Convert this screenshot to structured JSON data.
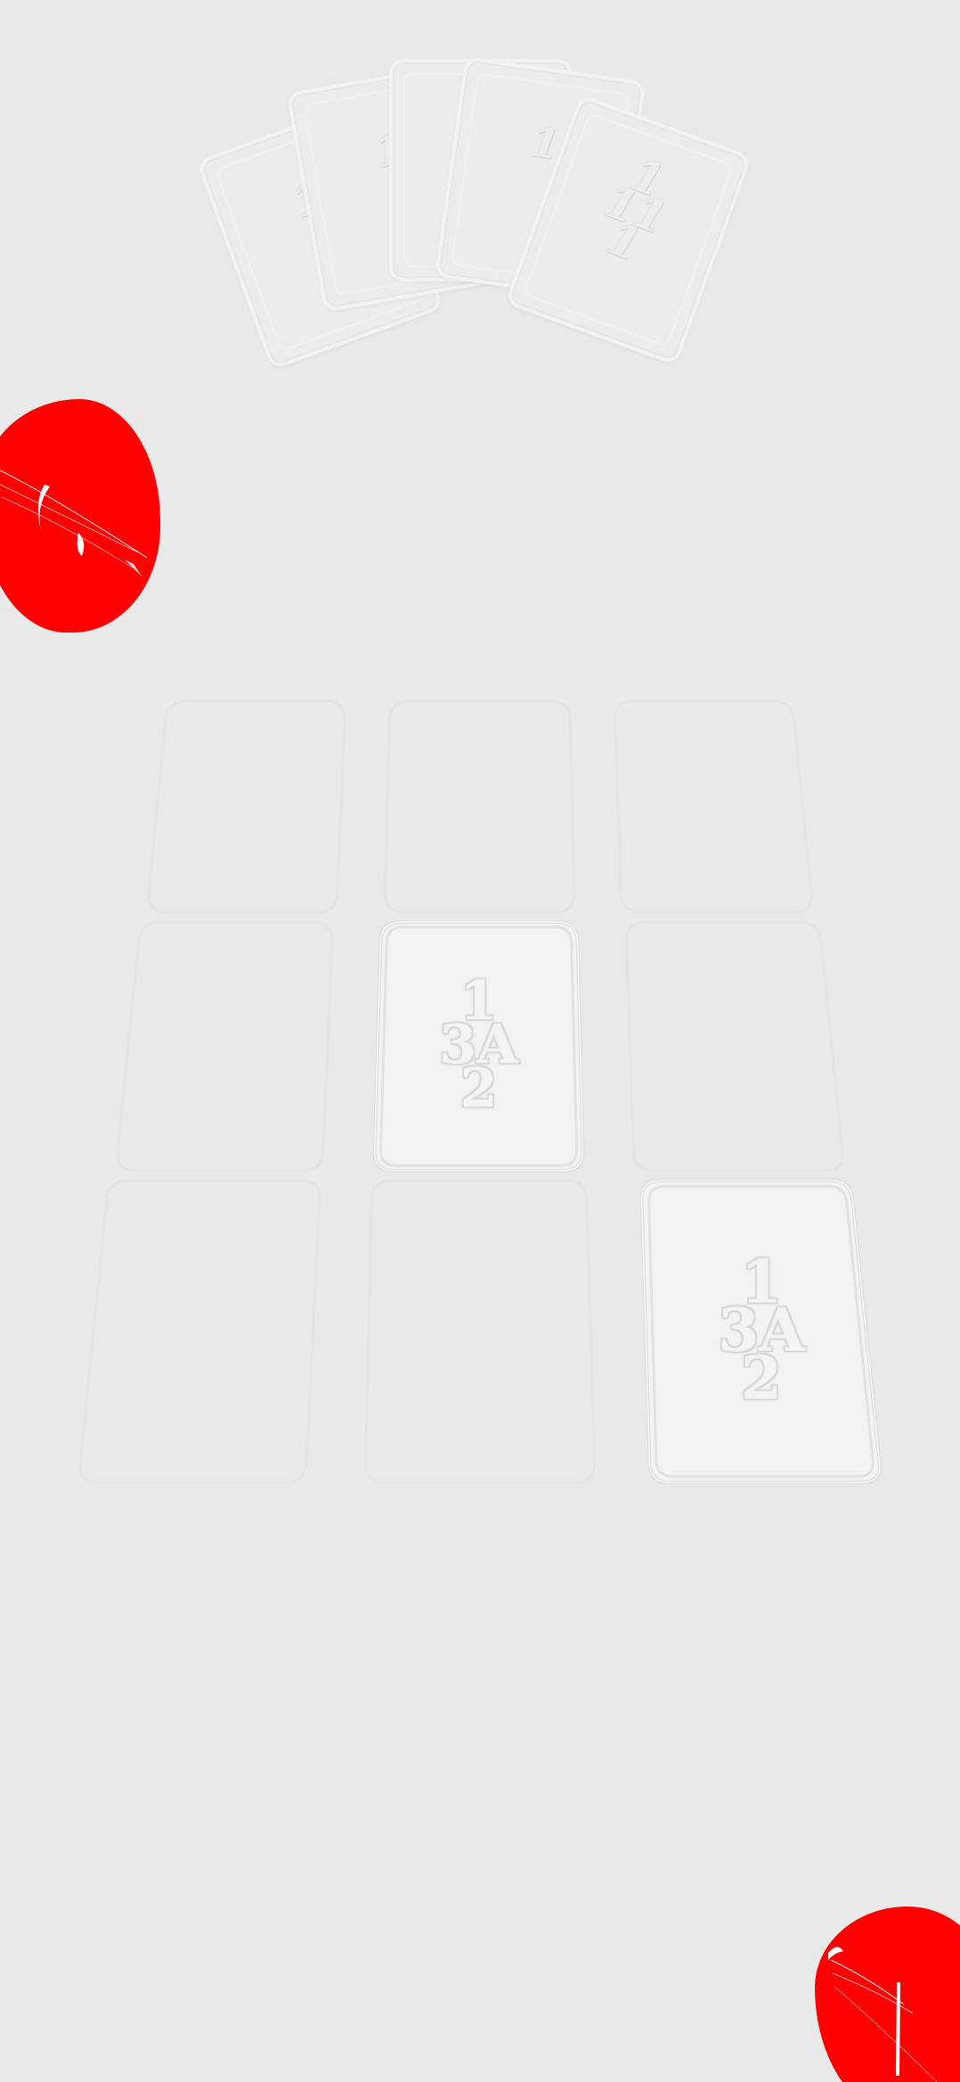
{
  "game": {
    "colors": {
      "background": "#e9e9e9",
      "token": "#ff0000",
      "card_face": "#f3f3f3",
      "slot_outline": "#e4e4e4"
    },
    "opponent_hand": {
      "cards": [
        {
          "rank": "1"
        },
        {
          "rank": "1"
        },
        {
          "rank": "1"
        },
        {
          "rank": "1"
        },
        {
          "rank": "1\n11\n1"
        }
      ]
    },
    "opponent_token": {
      "icon": "blood-splat-icon"
    },
    "player_token": {
      "icon": "blood-splat-icon"
    },
    "board": {
      "rows": [
        {
          "slots": [
            {
              "state": "empty"
            },
            {
              "state": "empty"
            },
            {
              "state": "empty"
            }
          ]
        },
        {
          "slots": [
            {
              "state": "empty"
            },
            {
              "state": "card",
              "top": "1",
              "middle": "3A",
              "bottom": "2"
            },
            {
              "state": "empty"
            }
          ]
        },
        {
          "slots": [
            {
              "state": "empty"
            },
            {
              "state": "empty"
            },
            {
              "state": "card",
              "top": "1",
              "middle": "3A",
              "bottom": "2"
            }
          ]
        }
      ]
    }
  }
}
